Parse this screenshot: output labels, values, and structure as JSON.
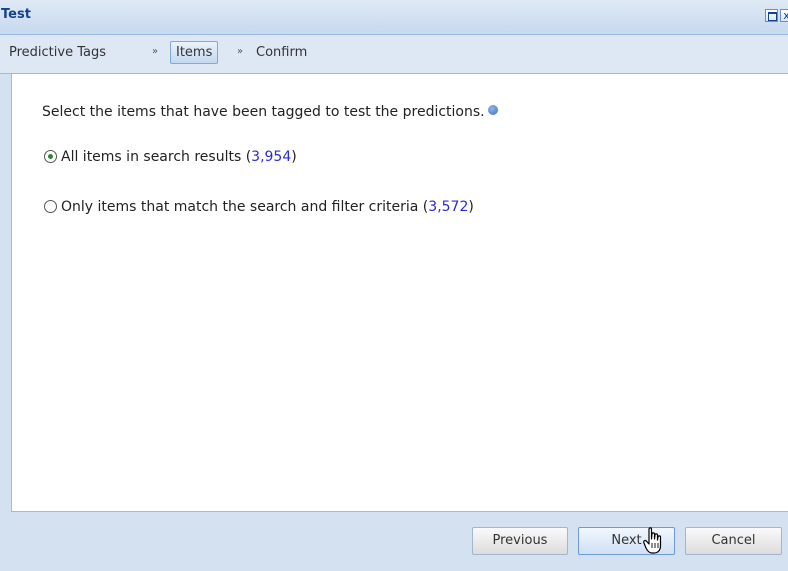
{
  "window": {
    "title": "Test",
    "close_glyph": "x"
  },
  "breadcrumb": {
    "steps": [
      {
        "label": "Predictive Tags"
      },
      {
        "label": "Items",
        "active": true
      },
      {
        "label": "Confirm"
      }
    ],
    "separator": "»"
  },
  "main": {
    "instruction": "Select the items that have been tagged to test the predictions.",
    "options": [
      {
        "label_prefix": "All items in search results (",
        "count": "3,954",
        "label_suffix": ")",
        "selected": true
      },
      {
        "label_prefix": "Only items that match the search and filter criteria (",
        "count": "3,572",
        "label_suffix": ")",
        "selected": false
      }
    ]
  },
  "footer": {
    "previous_label": "Previous",
    "next_label": "Next",
    "cancel_label": "Cancel"
  },
  "colors": {
    "title_text": "#15428b",
    "count_link": "#2b2bd6",
    "panel_bg": "#d3e1f1"
  },
  "icons": [
    "maximize-icon",
    "close-icon",
    "info-icon",
    "hand-cursor-icon"
  ]
}
